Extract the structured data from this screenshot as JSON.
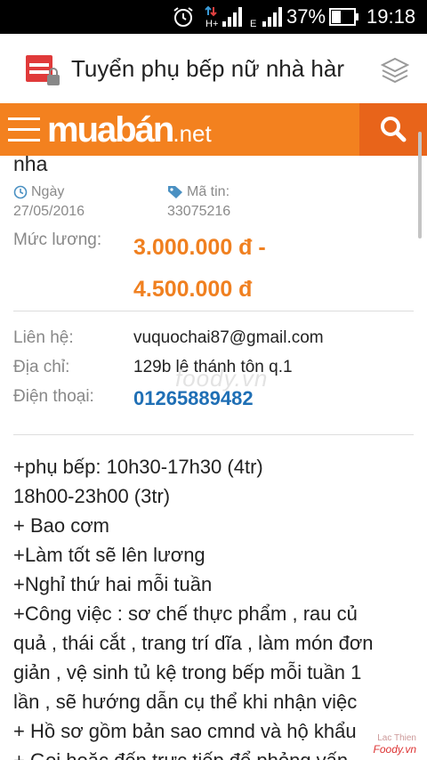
{
  "status_bar": {
    "battery_percent": "37%",
    "time": "19:18",
    "icons": [
      "alarm-icon",
      "h-plus-signal-icon",
      "e-signal-icon",
      "battery-icon"
    ]
  },
  "title_bar": {
    "title": "Tuyển phụ bếp nữ nhà hàr",
    "icons": [
      "app-icon",
      "layers-icon"
    ]
  },
  "site_header": {
    "logo_brand": "muabán",
    "logo_tld": ".net",
    "icons": [
      "menu-icon",
      "search-icon"
    ],
    "accent_color": "#f3811f"
  },
  "listing": {
    "title_tail": "nha",
    "date_label": "Ngày",
    "date_value": "27/05/2016",
    "id_label": "Mã tin:",
    "id_value": "33075216",
    "salary_label": "Mức lương:",
    "salary_line1": "3.000.000 đ -",
    "salary_line2": "4.500.000 đ",
    "contact_label": "Liên hệ:",
    "contact_value": "vuquochai87@gmail.com",
    "address_label": "Địa chỉ:",
    "address_value": "129b lê thánh tôn q.1",
    "phone_label": "Điện thoại:",
    "phone_value": "01265889482",
    "watermark": "foody.vn",
    "description": [
      "+phụ bếp: 10h30-17h30 (4tr)",
      "18h00-23h00 (3tr)",
      "+ Bao cơm",
      "+Làm tốt sẽ lên lương",
      "+Nghỉ thứ hai mỗi tuần",
      "+Công việc : sơ chế thực phẩm , rau củ",
      "quả , thái cắt , trang trí dĩa , làm món đơn",
      "giản , vệ sinh tủ kệ trong bếp mỗi tuần 1",
      "lần , sẽ hướng dẫn cụ thể khi nhận việc",
      "+ Hồ sơ gồm bản sao cmnd và hộ khẩu",
      "+ Gọi hoặc đến trực tiếp để phỏng vấn"
    ]
  },
  "corner_mark": {
    "line1": "Lac Thien",
    "line2": "Foody.vn"
  }
}
